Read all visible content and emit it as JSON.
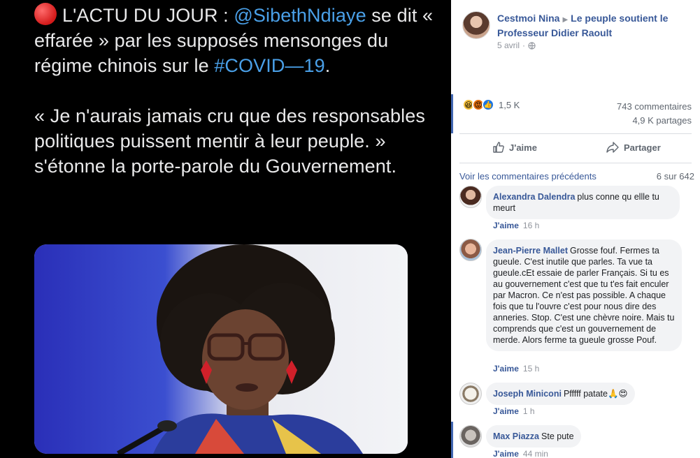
{
  "tweet": {
    "line1_prefix": "L'ACTU DU JOUR : ",
    "mention": "@SibethNdiaye",
    "line1_suffix": " se dit « effarée » par les supposés mensonges du régime chinois sur le ",
    "hashtag": "#COVID—19",
    "line1_end": ".",
    "quote": "« Je n'aurais jamais cru que des responsables politiques puissent mentir à leur peuple. » s'étonne la porte-parole du Gouvernement."
  },
  "post": {
    "author": "Cestmoi Nina",
    "group": "Le peuple soutient le Professeur Didier Raoult",
    "date": "5 avril",
    "separator": "·",
    "reaction_count": "1,5 K",
    "comments_count": "743 commentaires",
    "shares_count": "4,9 K partages",
    "like_label": "J'aime",
    "share_label": "Partager"
  },
  "comments_header": {
    "view_previous": "Voir les commentaires précédents",
    "count": "6 sur 642"
  },
  "comments": [
    {
      "name": "Alexandra Dalendra",
      "text": "plus conne qu ellle tu meurt",
      "like": "J'aime",
      "time": "16 h"
    },
    {
      "name": "Jean-Pierre Mallet",
      "text": "Grosse fouf. Fermes ta gueule. C'est inutile que parles. Ta vue ta gueule.cEt essaie de parler Français. Si tu es au gouvernement c'est que tu t'es fait enculer par Macron. Ce n'est pas possible. A chaque fois que tu l'ouvre c'est pour nous dire des anneries. Stop. C'est une chèvre noire. Mais tu comprends que c'est un gouvernement de merde. Alors ferme ta gueule grosse Pouf.",
      "like": "J'aime",
      "time": "15 h"
    },
    {
      "name": "Joseph Miniconi",
      "text": "Pfffff patate🙏😍",
      "like": "J'aime",
      "time": "1 h"
    },
    {
      "name": "Max Piazza",
      "text": "Ste pute",
      "like": "J'aime",
      "time": "44 min"
    }
  ],
  "colors": {
    "link": "#385898",
    "accent": "#4267b2",
    "muted": "#90949c",
    "bubble": "#f2f3f5"
  },
  "icons": [
    "red-circle-icon",
    "globe-icon",
    "haha-reaction-icon",
    "angry-reaction-icon",
    "like-reaction-icon",
    "thumbs-up-icon",
    "share-arrow-icon"
  ]
}
